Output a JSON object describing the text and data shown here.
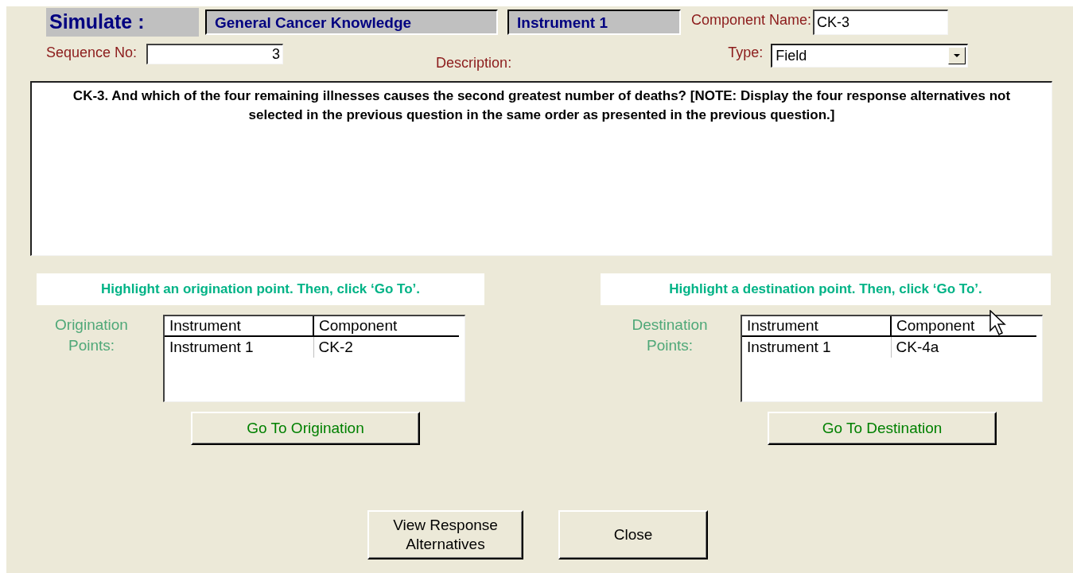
{
  "header": {
    "title": "Simulate :",
    "survey": "General Cancer Knowledge",
    "instrument": "Instrument 1"
  },
  "component_name": {
    "label": "Component Name:",
    "value": "CK-3"
  },
  "sequence": {
    "label": "Sequence No:",
    "value": "3"
  },
  "description": {
    "label": "Description:",
    "text": "CK-3. And which of the four remaining illnesses causes the second greatest number of deaths? [NOTE: Display the four response alternatives not selected in the previous question in the same order as presented in the previous question.]"
  },
  "type": {
    "label": "Type:",
    "value": "Field"
  },
  "panels": [
    {
      "hint": "Highlight an origination point. Then, click ‘Go To’.",
      "label": "Origination Points:",
      "columns": [
        "Instrument",
        "Component"
      ],
      "rows": [
        [
          "Instrument 1",
          "CK-2"
        ]
      ],
      "button": "Go To Origination"
    },
    {
      "hint": "Highlight a destination point. Then, click ‘Go To’.",
      "label": "Destination Points:",
      "columns": [
        "Instrument",
        "Component"
      ],
      "rows": [
        [
          "Instrument 1",
          "CK-4a"
        ]
      ],
      "button": "Go To Destination"
    }
  ],
  "buttons": [
    "View Response Alternatives",
    "Close"
  ]
}
